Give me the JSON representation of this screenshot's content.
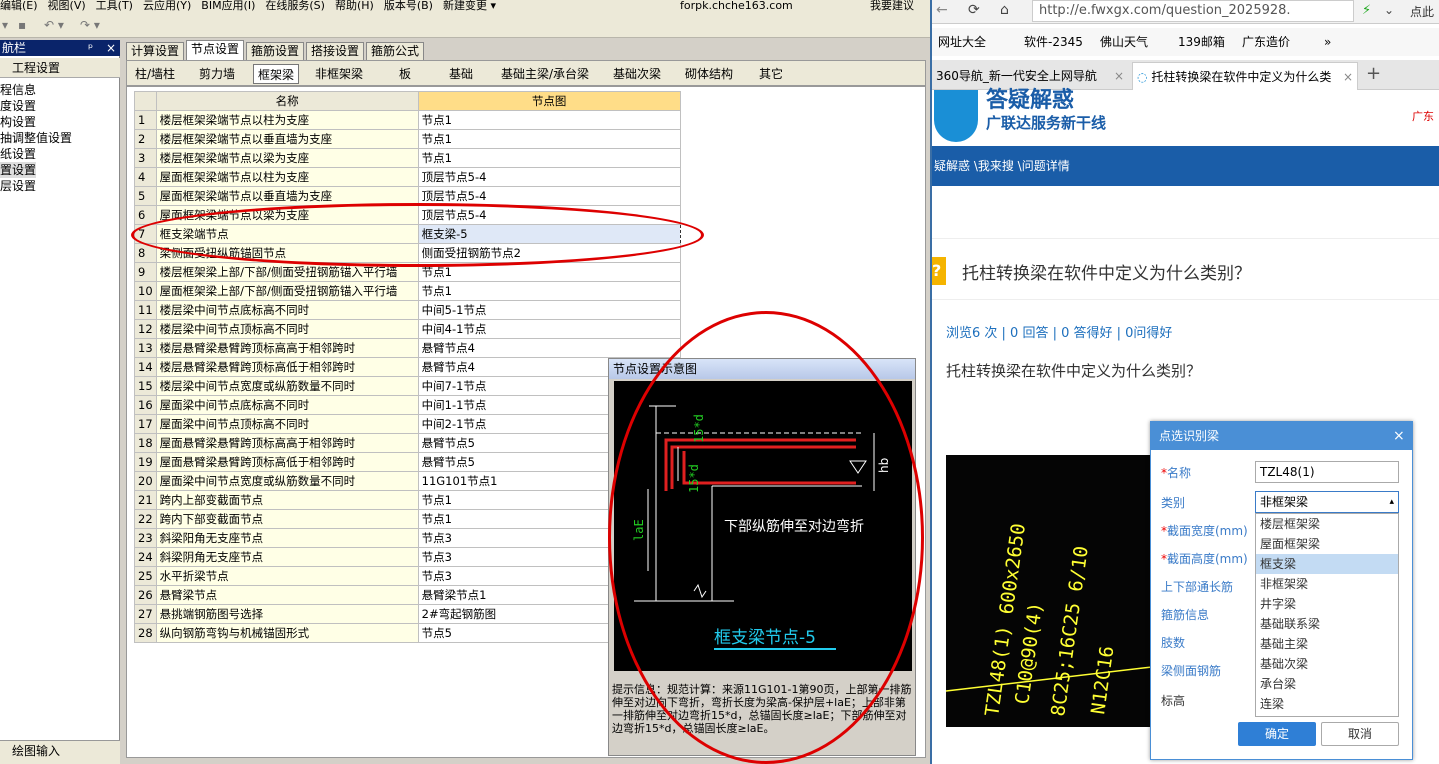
{
  "menubar": [
    "编辑(E)",
    "视图(V)",
    "工具(T)",
    "云应用(Y)",
    "BIM应用(I)",
    "在线服务(S)",
    "帮助(H)",
    "版本号(B)",
    "新建变更 ▾"
  ],
  "menubar_right": "forpk.chche163.com",
  "menubar_right2": "我要建议",
  "sidebar": {
    "title": "航栏",
    "pin": "ᵖ",
    "close": "×",
    "header": "工程设置",
    "items": [
      "程信息",
      "度设置",
      "构设置",
      "抽调整值设置",
      "纸设置",
      "置设置",
      "层设置"
    ],
    "footer": "绘图输入"
  },
  "tabs1": [
    "计算设置",
    "节点设置",
    "箍筋设置",
    "搭接设置",
    "箍筋公式"
  ],
  "tabs2": [
    "柱/墙柱",
    "剪力墙",
    "框架梁",
    "非框架梁",
    "板",
    "基础",
    "基础主梁/承台梁",
    "基础次梁",
    "砌体结构",
    "其它"
  ],
  "grid": {
    "headers": [
      "名称",
      "节点图"
    ],
    "rows": [
      [
        "1",
        "楼层框架梁端节点以柱为支座",
        "节点1"
      ],
      [
        "2",
        "楼层框架梁端节点以垂直墙为支座",
        "节点1"
      ],
      [
        "3",
        "楼层框架梁端节点以梁为支座",
        "节点1"
      ],
      [
        "4",
        "屋面框架梁端节点以柱为支座",
        "顶层节点5-4"
      ],
      [
        "5",
        "屋面框架梁端节点以垂直墙为支座",
        "顶层节点5-4"
      ],
      [
        "6",
        "屋面框架梁端节点以梁为支座",
        "顶层节点5-4"
      ],
      [
        "7",
        "框支梁端节点",
        "框支梁-5"
      ],
      [
        "8",
        "梁侧面受扭纵筋锚固节点",
        "侧面受扭钢筋节点2"
      ],
      [
        "9",
        "楼层框架梁上部/下部/侧面受扭钢筋锚入平行墙",
        "节点1"
      ],
      [
        "10",
        "屋面框架梁上部/下部/侧面受扭钢筋锚入平行墙",
        "节点1"
      ],
      [
        "11",
        "楼层梁中间节点底标高不同时",
        "中间5-1节点"
      ],
      [
        "12",
        "楼层梁中间节点顶标高不同时",
        "中间4-1节点"
      ],
      [
        "13",
        "楼层悬臂梁悬臂跨顶标高高于相邻跨时",
        "悬臂节点4"
      ],
      [
        "14",
        "楼层悬臂梁悬臂跨顶标高低于相邻跨时",
        "悬臂节点4"
      ],
      [
        "15",
        "楼层梁中间节点宽度或纵筋数量不同时",
        "中间7-1节点"
      ],
      [
        "16",
        "屋面梁中间节点底标高不同时",
        "中间1-1节点"
      ],
      [
        "17",
        "屋面梁中间节点顶标高不同时",
        "中间2-1节点"
      ],
      [
        "18",
        "屋面悬臂梁悬臂跨顶标高高于相邻跨时",
        "悬臂节点5"
      ],
      [
        "19",
        "屋面悬臂梁悬臂跨顶标高低于相邻跨时",
        "悬臂节点5"
      ],
      [
        "20",
        "屋面梁中间节点宽度或纵筋数量不同时",
        "11G101节点1"
      ],
      [
        "21",
        "跨内上部变截面节点",
        "节点1"
      ],
      [
        "22",
        "跨内下部变截面节点",
        "节点1"
      ],
      [
        "23",
        "斜梁阳角无支座节点",
        "节点3"
      ],
      [
        "24",
        "斜梁阴角无支座节点",
        "节点3"
      ],
      [
        "25",
        "水平折梁节点",
        "节点3"
      ],
      [
        "26",
        "悬臂梁节点",
        "悬臂梁节点1"
      ],
      [
        "27",
        "悬挑端钢筋图号选择",
        "2#弯起钢筋图"
      ],
      [
        "28",
        "纵向钢筋弯钩与机械锚固形式",
        "节点5"
      ]
    ]
  },
  "schematic": {
    "title": "节点设置示意图",
    "dim_15d": "15*d",
    "dim_15d_2": "15*d",
    "dim_hb": "hb",
    "dim_lae": "laE",
    "note": "下部纵筋伸至对边弯折",
    "caption": "框支梁节点-5",
    "hint_label": "提示信息：",
    "hint": "规范计算：来源11G101-1第90页，上部第一排筋伸至对边向下弯折，弯折长度为梁高-保护层+laE；上部非第一排筋伸至对边弯折15*d，总锚固长度≥laE；下部筋伸至对边弯折15*d，总锚固长度≥laE。"
  },
  "browser": {
    "url": "http://e.fwxgx.com/question_2025928.",
    "url_right": "点此",
    "bookmarks": [
      "网址大全",
      "软件-2345",
      "佛山天气",
      "139邮箱",
      "广东造价",
      "»"
    ],
    "tabs": [
      "360导航_新一代安全上网导航",
      "托柱转换梁在软件中定义为什么类"
    ],
    "banner_title": "答疑解惑",
    "banner_sub": "广联达服务新干线",
    "banner_right": "广东",
    "breadcrumb": "疑解惑 \\我来搜 \\问题详情",
    "question_title": "托柱转换梁在软件中定义为什么类别？",
    "meta": "浏览6 次 | 0 回答 | 0 答得好 | 0问得好",
    "question_body": "托柱转换梁在软件中定义为什么类别？",
    "photo_lines": [
      "TZL48(1) 600x2650",
      "C10@90(4)",
      "8C25;16C25 6/10",
      "N12C16"
    ]
  },
  "popup": {
    "title": "点选识别梁",
    "close": "×",
    "labels": [
      "名称",
      "类别",
      "截面宽度(mm)",
      "截面高度(mm)",
      "上下部通长筋",
      "箍筋信息",
      "肢数",
      "梁侧面钢筋",
      "标高"
    ],
    "name_value": "TZL48(1)",
    "category_value": "非框架梁",
    "options": [
      "楼层框架梁",
      "屋面框架梁",
      "框支梁",
      "非框架梁",
      "井字梁",
      "基础联系梁",
      "基础主梁",
      "基础次梁",
      "承台梁",
      "连梁"
    ],
    "selected_option": "框支梁",
    "ok": "确定",
    "cancel": "取消"
  },
  "colors": {
    "accent_red": "#dd0000",
    "browser_blue": "#1a5da8",
    "popup_blue": "#4a8fd6",
    "rebar_red": "#e02020",
    "dim_green": "#22cc22"
  }
}
